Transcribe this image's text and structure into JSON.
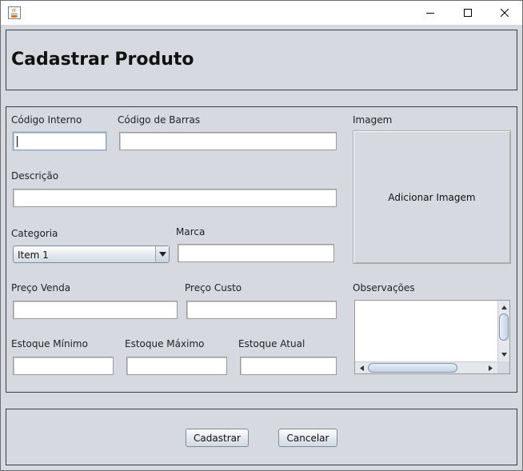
{
  "window": {
    "title": ""
  },
  "header": {
    "title": "Cadastrar Produto"
  },
  "form": {
    "codigo_interno": {
      "label": "Código Interno",
      "value": ""
    },
    "codigo_barras": {
      "label": "Código de Barras",
      "value": ""
    },
    "descricao": {
      "label": "Descrição",
      "value": ""
    },
    "categoria": {
      "label": "Categoria",
      "selected": "Item 1"
    },
    "marca": {
      "label": "Marca",
      "value": ""
    },
    "preco_venda": {
      "label": "Preço Venda",
      "value": ""
    },
    "preco_custo": {
      "label": "Preço Custo",
      "value": ""
    },
    "estoque_minimo": {
      "label": "Estoque Mínimo",
      "value": ""
    },
    "estoque_maximo": {
      "label": "Estoque Máximo",
      "value": ""
    },
    "estoque_atual": {
      "label": "Estoque Atual",
      "value": ""
    },
    "imagem": {
      "label": "Imagem",
      "button_label": "Adicionar Imagem"
    },
    "observacoes": {
      "label": "Observações",
      "value": ""
    }
  },
  "footer": {
    "cadastrar_label": "Cadastrar",
    "cancelar_label": "Cancelar"
  },
  "icons": {
    "app": "java-coffee-cup-icon",
    "minimize": "minimize-icon",
    "maximize": "maximize-icon",
    "close": "close-icon"
  },
  "colors": {
    "background": "#d6d9df",
    "border": "#3c3c3c",
    "titlebar": "#ffffff"
  }
}
